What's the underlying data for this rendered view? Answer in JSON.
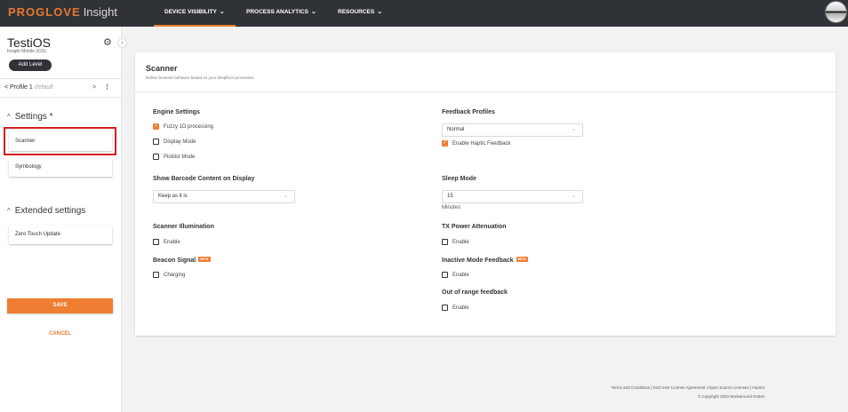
{
  "topbar": {
    "brand": "PROGLOVE",
    "brand_suffix": "Insight",
    "nav": [
      {
        "label": "DEVICE VISIBILITY",
        "icon": "chevron-down-icon"
      },
      {
        "label": "PROCESS ANALYTICS",
        "icon": "chevron-down-icon"
      },
      {
        "label": "RESOURCES",
        "icon": "chevron-down-icon"
      }
    ]
  },
  "sidebar": {
    "app_name": "TestiOS",
    "app_sub": "Insight Mobile (iOS)",
    "add_level": "Add Level",
    "profile": {
      "prefix": "<",
      "name": "Profile 1",
      "tag": "default",
      "next": ">",
      "menu": "⋮"
    },
    "settings_title": "Settings *",
    "settings_items": [
      "Scanner",
      "Symbology"
    ],
    "extended_title": "Extended settings",
    "extended_items": [
      "Zero Touch Update"
    ],
    "save": "SAVE",
    "cancel": "CANCEL"
  },
  "card": {
    "title": "Scanner",
    "description": "Define Scanner behavior based on your shopfloor processes.",
    "engine": {
      "label": "Engine Settings",
      "options": [
        {
          "label": "Fuzzy 1D processing",
          "checked": true
        },
        {
          "label": "Display Mode",
          "checked": false
        },
        {
          "label": "Picklist Mode",
          "checked": false
        }
      ]
    },
    "barcode": {
      "label": "Show Barcode Content on Display",
      "value": "Keep as it is"
    },
    "illumination": {
      "label": "Scanner Illumination",
      "option": "Enable",
      "checked": false
    },
    "beacon": {
      "label": "Beacon Signal",
      "badge": "BETA",
      "option": "Charging",
      "checked": false
    },
    "feedback": {
      "label": "Feedback Profiles",
      "value": "Normal",
      "option": "Enable Haptic Feedback",
      "checked": true
    },
    "sleep": {
      "label": "Sleep Mode",
      "value": "15",
      "unit": "Minutes"
    },
    "tx": {
      "label": "TX Power Attenuation",
      "option": "Enable",
      "checked": false
    },
    "inactive": {
      "label": "Inactive Mode Feedback",
      "badge": "BETA",
      "option": "Enable",
      "checked": false
    },
    "range": {
      "label": "Out of range feedback",
      "option": "Enable",
      "checked": false
    }
  },
  "footer": {
    "links": "Terms and Conditions | End User License Agreement | Open Source Licenses | Imprint",
    "copyright": "© Copyright 2023 Workaround GmbH"
  },
  "colors": {
    "accent": "#ef7d32",
    "topbar": "#2f3338",
    "highlight": "#d32020"
  }
}
